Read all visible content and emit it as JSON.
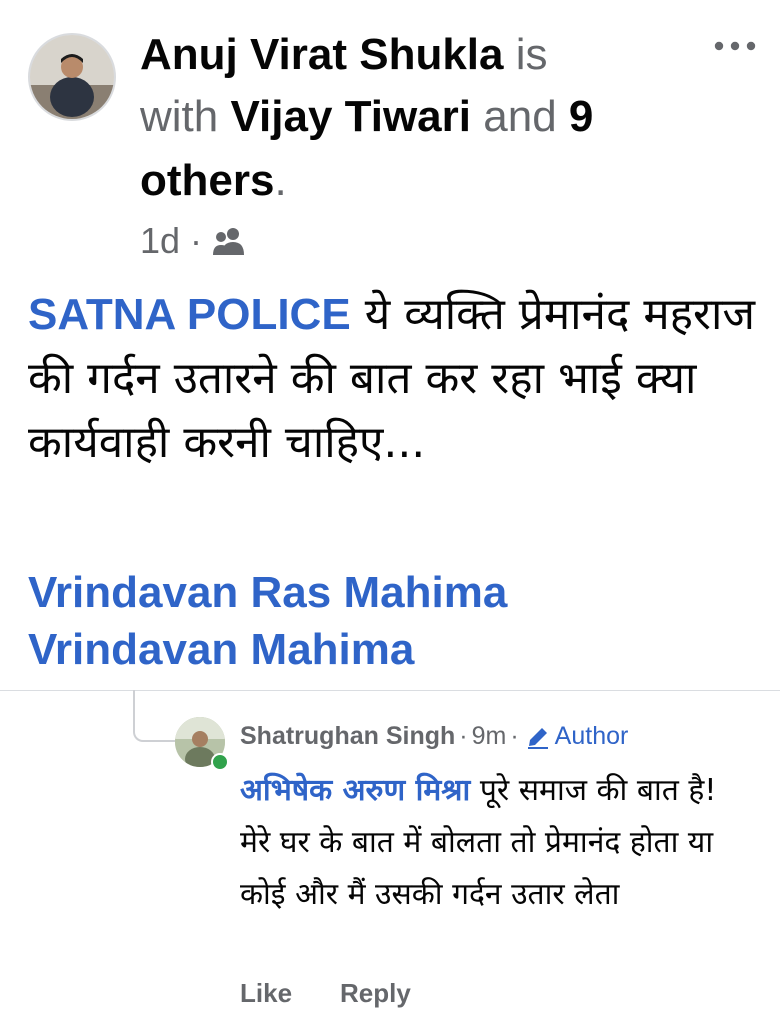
{
  "post": {
    "author": "Anuj Virat Shukla",
    "is_text": "is",
    "with_text": "with",
    "tagged_person": "Vijay Tiwari",
    "and_text": "and",
    "others_count": "9",
    "others_text": "others",
    "period": ".",
    "timestamp": "1d",
    "dot": "·",
    "audience_icon": "friends-icon",
    "mention": "SATNA POLICE",
    "text": "ये व्यक्ति प्रेमानंद महराज की गर्दन उतारने की बात कर रहा भाई क्या कार्यवाही करनी चाहिए...",
    "tags": [
      "Vrindavan Ras Mahima",
      "Vrindavan Mahima"
    ]
  },
  "comment": {
    "author": "Shatrughan Singh",
    "dot": "·",
    "time": "9m",
    "badge": "Author",
    "mention": "अभिषेक अरुण मिश्रा",
    "text": "पूरे समाज की बात है! मेरे घर के बात में बोलता तो प्रेमानंद होता या कोई और मैं उसकी गर्दन उतार लेता",
    "actions": {
      "like": "Like",
      "reply": "Reply"
    }
  },
  "colors": {
    "link": "#2f64c8",
    "muted": "#65676b",
    "online": "#31a24c"
  }
}
